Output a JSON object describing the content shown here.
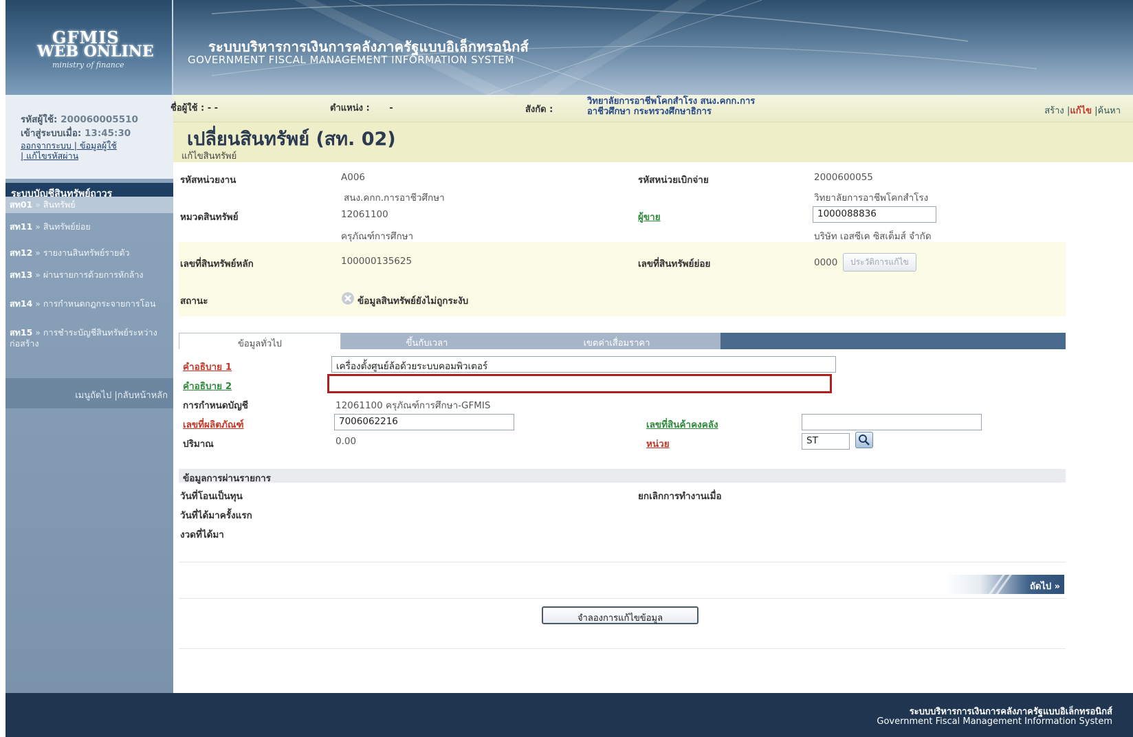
{
  "header": {
    "logo_line1": "GFMIS",
    "logo_line2": "WEB ONLINE",
    "logo_line3": "ministry of finance",
    "title_th": "ระบบบริหารการเงินการคลังภาครัฐแบบอิเล็กทรอนิกส์",
    "title_en": "GOVERNMENT FISCAL MANAGEMENT INFORMATION SYSTEM"
  },
  "user": {
    "id_label": "รหัสผู้ใช้:",
    "id_value": "200060005510",
    "login_label": "เข้าสู่ระบบเมื่อ:",
    "login_time": "13:45:30",
    "logout_link": "ออกจากระบบ | ข้อมูลผู้ใช้",
    "change_pw_link": "| แก้ไขรหัสผ่าน"
  },
  "menu": {
    "title": "ระบบบัญชีสินทรัพย์ถาวร",
    "items": [
      {
        "code": "สท01",
        "label": "สินทรัพย์"
      },
      {
        "code": "สท11",
        "label": "สินทรัพย์ย่อย"
      },
      {
        "code": "สท12",
        "label": "รายงานสินทรัพย์รายตัว"
      },
      {
        "code": "สท13",
        "label": "ผ่านรายการด้วยการหักล้าง"
      },
      {
        "code": "สท14",
        "label": "การกำหนดกฎกระจายการโอน"
      },
      {
        "code": "สท15",
        "label": "การชำระบัญชีสินทรัพย์ระหว่างก่อสร้าง"
      }
    ],
    "bottom": "เมนูถัดไป |กลับหน้าหลัก"
  },
  "topbar": {
    "user_label": "ชื่อผู้ใช้ :",
    "user_value": "- -",
    "position_label": "ตำแหน่ง :",
    "position_value": "-",
    "org_label": "สังกัด :",
    "org_value_1": "วิทยาลัยการอาชีพโคกสำโรง สนง.คกก.การ",
    "org_value_2": "อาชีวศึกษา กระทรวงศึกษาธิการ",
    "action_create": "สร้าง",
    "action_edit": "แก้ไข",
    "action_search": "ค้นหา"
  },
  "page": {
    "title": "เปลี่ยนสินทรัพย์ (สท. 02)",
    "subtitle": "แก้ไขสินทรัพย์"
  },
  "info": {
    "agency_label": "รหัสหน่วยงาน",
    "agency_code": "A006",
    "agency_name": "สนง.คกก.การอาชีวศึกษา",
    "disb_label": "รหัสหน่วยเบิกจ่าย",
    "disb_code": "2000600055",
    "disb_name": "วิทยาลัยการอาชีพโคกสำโรง",
    "category_label": "หมวดสินทรัพย์",
    "category_code": "12061100",
    "category_name": "ครุภัณฑ์การศึกษา",
    "vendor_label": "ผู้ขาย",
    "vendor_code": "1000088836",
    "vendor_name": "บริษัท เอสซีเค ซิสเต็มส์ จำกัด",
    "main_asset_label": "เลขที่สินทรัพย์หลัก",
    "main_asset_value": "100000135625",
    "sub_asset_label": "เลขที่สินทรัพย์ย่อย",
    "sub_asset_value": "0000",
    "history_button": "ประวัติการแก้ไข",
    "status_label": "สถานะ",
    "status_value": "ข้อมูลสินทรัพย์ยังไม่ถูกระงับ"
  },
  "tabs": {
    "general": "ข้อมูลทั่วไป",
    "time": "ขึ้นกับเวลา",
    "depreciation": "เขตค่าเสื่อมราคา"
  },
  "form": {
    "desc1_label": "คำอธิบาย 1",
    "desc1_value": "เครื่องตั้งศูนย์ล้อด้วยระบบคอมพิวเตอร์",
    "desc2_label": "คำอธิบาย 2",
    "desc2_value": "",
    "account_label": "การกำหนดบัญชี",
    "account_value": "12061100 ครุภัณฑ์การศึกษา-GFMIS",
    "product_label": "เลขที่ผลิตภัณฑ์",
    "product_value": "7006062216",
    "inventory_label": "เลขที่สินค้าคงคลัง",
    "inventory_value": "",
    "quantity_label": "ปริมาณ",
    "quantity_value": "0.00",
    "unit_label": "หน่วย",
    "unit_value": "ST"
  },
  "posting": {
    "section_title": "ข้อมูลการผ่านรายการ",
    "capitalized_label": "วันที่โอนเป็นทุน",
    "deactivated_label": "ยกเลิกการทำงานเมื่อ",
    "acquired_first_label": "วันที่ได้มาครั้งแรก",
    "acquired_period_label": "งวดที่ได้มา"
  },
  "buttons": {
    "next": "ถัดไป »",
    "simulate": "จำลองการแก้ไขข้อมูล"
  },
  "footer": {
    "th": "ระบบบริหารการเงินการคลังภาครัฐแบบอิเล็กทรอนิกส์",
    "en": "Government Fiscal Management Information System"
  },
  "colors": {
    "header_blue": "#2d4e6c",
    "menu_title": "#1f3f62",
    "link_red": "#c0392b",
    "link_green": "#2f8a3c",
    "highlight_border": "#b01e1e"
  }
}
